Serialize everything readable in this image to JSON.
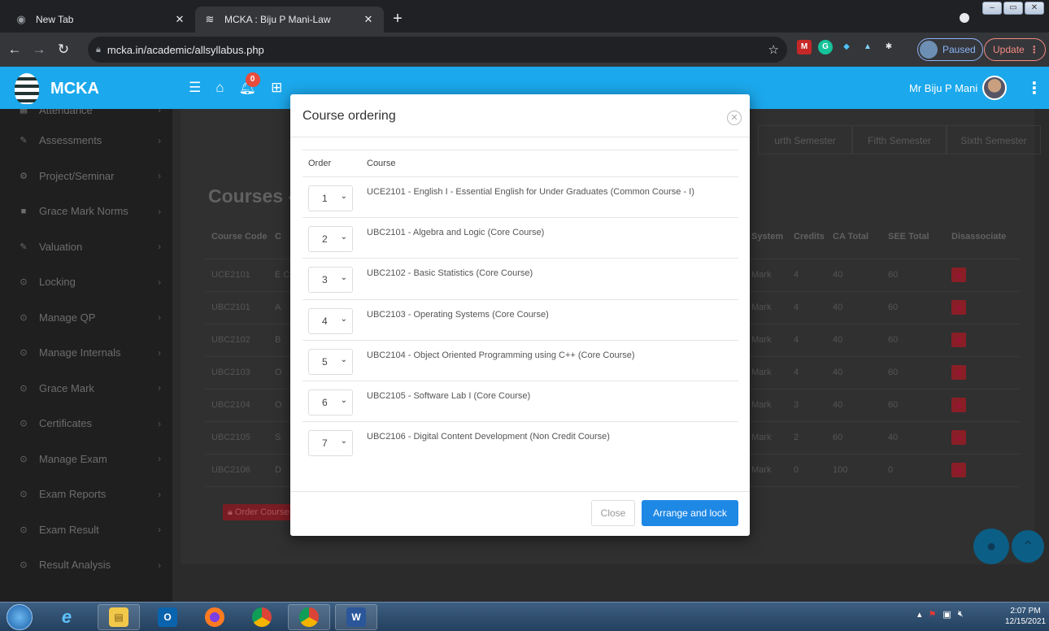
{
  "browser": {
    "tabs": [
      {
        "title": "New Tab",
        "icon": "chrome-icon"
      },
      {
        "title": "MCKA : Biju P Mani-Law",
        "icon": "mcka-favicon"
      }
    ],
    "url": "mcka.in/academic/allsyllabus.php",
    "profile_status": "Paused",
    "update_label": "Update"
  },
  "app": {
    "brand": "MCKA",
    "notification_count": "0",
    "user_name": "Mr Biju P Mani",
    "accent": "#1ba8ec"
  },
  "sidebar": {
    "items": [
      {
        "label": "Attendance",
        "icon": "calendar-icon"
      },
      {
        "label": "Assessments",
        "icon": "pencil-icon"
      },
      {
        "label": "Project/Seminar",
        "icon": "gears-icon"
      },
      {
        "label": "Grace Mark Norms",
        "icon": "book-icon"
      },
      {
        "label": "Valuation",
        "icon": "pencil-icon"
      },
      {
        "label": "Locking",
        "icon": "circle-arrow-icon"
      },
      {
        "label": "Manage QP",
        "icon": "circle-arrow-icon"
      },
      {
        "label": "Manage Internals",
        "icon": "circle-arrow-icon"
      },
      {
        "label": "Grace Mark",
        "icon": "circle-arrow-icon"
      },
      {
        "label": "Certificates",
        "icon": "circle-arrow-icon"
      },
      {
        "label": "Manage Exam",
        "icon": "circle-arrow-icon"
      },
      {
        "label": "Exam Reports",
        "icon": "circle-arrow-icon"
      },
      {
        "label": "Exam Result",
        "icon": "circle-arrow-icon"
      },
      {
        "label": "Result Analysis",
        "icon": "circle-arrow-icon"
      }
    ]
  },
  "background": {
    "semester_tabs": [
      "urth Semester",
      "Fifth Semester",
      "Sixth Semester"
    ],
    "courses_title": "Courses -",
    "table_headers": [
      "Course Code",
      "C",
      "System",
      "Credits",
      "CA Total",
      "SEE Total",
      "Disassociate"
    ],
    "rows": [
      {
        "code": "UCE2101",
        "c": "E C",
        "system": "Mark",
        "credits": "4",
        "ca": "40",
        "see": "60"
      },
      {
        "code": "UBC2101",
        "c": "A",
        "system": "Mark",
        "credits": "4",
        "ca": "40",
        "see": "60"
      },
      {
        "code": "UBC2102",
        "c": "B",
        "system": "Mark",
        "credits": "4",
        "ca": "40",
        "see": "60"
      },
      {
        "code": "UBC2103",
        "c": "O",
        "system": "Mark",
        "credits": "4",
        "ca": "40",
        "see": "60"
      },
      {
        "code": "UBC2104",
        "c": "O",
        "system": "Mark",
        "credits": "3",
        "ca": "40",
        "see": "60"
      },
      {
        "code": "UBC2105",
        "c": "S",
        "system": "Mark",
        "credits": "2",
        "ca": "60",
        "see": "40"
      },
      {
        "code": "UBC2106",
        "c": "D",
        "system": "Mark",
        "credits": "0",
        "ca": "100",
        "see": "0"
      }
    ],
    "order_button": "Order Course"
  },
  "modal": {
    "title": "Course ordering",
    "col_order": "Order",
    "col_course": "Course",
    "rows": [
      {
        "order": "1",
        "course": "UCE2101 - English I - Essential English for Under Graduates (Common Course - I)"
      },
      {
        "order": "2",
        "course": "UBC2101 - Algebra and Logic (Core Course)"
      },
      {
        "order": "3",
        "course": "UBC2102 - Basic Statistics (Core Course)"
      },
      {
        "order": "4",
        "course": "UBC2103 - Operating Systems (Core Course)"
      },
      {
        "order": "5",
        "course": "UBC2104 - Object Oriented Programming using C++ (Core Course)"
      },
      {
        "order": "6",
        "course": "UBC2105 - Software Lab I (Core Course)"
      },
      {
        "order": "7",
        "course": "UBC2106 - Digital Content Development (Non Credit Course)"
      }
    ],
    "close_label": "Close",
    "arrange_label": "Arrange and lock",
    "primary_color": "#1e88e5"
  },
  "taskbar": {
    "time": "2:07 PM",
    "date": "12/15/2021"
  }
}
